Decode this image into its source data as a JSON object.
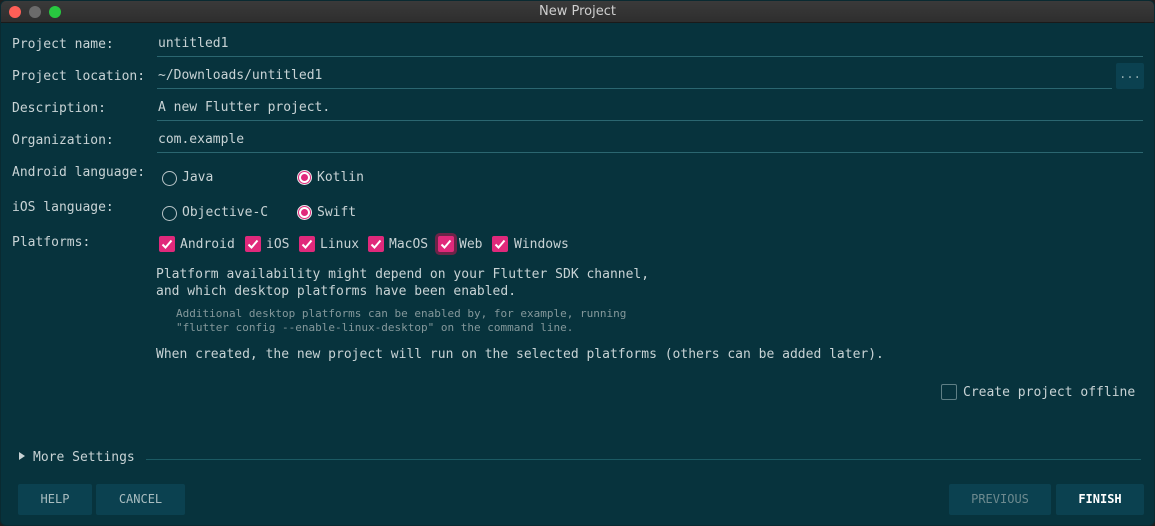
{
  "window": {
    "title": "New Project"
  },
  "form": {
    "project_name": {
      "label": "Project name:",
      "value": "untitled1"
    },
    "project_location": {
      "label": "Project location:",
      "value": "~/Downloads/untitled1",
      "browse_label": "..."
    },
    "description": {
      "label": "Description:",
      "value": "A new Flutter project."
    },
    "organization": {
      "label": "Organization:",
      "value": "com.example"
    },
    "android_language": {
      "label": "Android language:",
      "options": [
        "Java",
        "Kotlin"
      ],
      "selected": "Kotlin"
    },
    "ios_language": {
      "label": "iOS language:",
      "options": [
        "Objective-C",
        "Swift"
      ],
      "selected": "Swift"
    },
    "platforms": {
      "label": "Platforms:",
      "items": [
        {
          "label": "Android",
          "checked": true
        },
        {
          "label": "iOS",
          "checked": true
        },
        {
          "label": "Linux",
          "checked": true
        },
        {
          "label": "MacOS",
          "checked": true
        },
        {
          "label": "Web",
          "checked": true
        },
        {
          "label": "Windows",
          "checked": true
        }
      ]
    },
    "notes": {
      "availability_line1": "Platform availability might depend on your Flutter SDK channel,",
      "availability_line2": "and which desktop platforms have been enabled.",
      "additional_line1": "Additional desktop platforms can be enabled by, for example, running",
      "additional_line2": "\"flutter config --enable-linux-desktop\" on the command line.",
      "created": "When created, the new project will run on the selected platforms (others can be added later)."
    },
    "offline": {
      "label": "Create project offline",
      "checked": false
    },
    "more_settings": "More Settings"
  },
  "buttons": {
    "help": "HELP",
    "cancel": "CANCEL",
    "previous": "PREVIOUS",
    "finish": "FINISH"
  },
  "colors": {
    "background": "#07333d",
    "accent": "#e0297b",
    "button_bg": "#0b4150"
  }
}
